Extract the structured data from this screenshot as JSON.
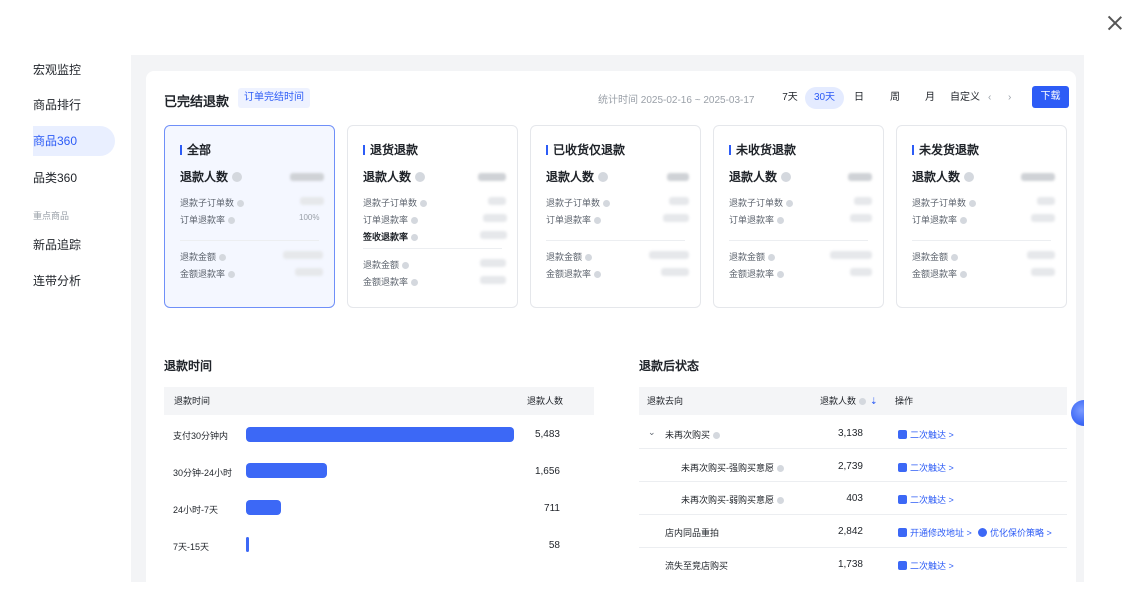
{
  "sidebar": {
    "items": [
      {
        "label": "宏观监控"
      },
      {
        "label": "商品排行"
      },
      {
        "label": "商品360"
      },
      {
        "label": "品类360"
      },
      {
        "label": "新品追踪"
      },
      {
        "label": "连带分析"
      }
    ],
    "group_label": "重点商品"
  },
  "header": {
    "title": "已完结退款",
    "tag": "订单完结时间",
    "stat_time": "统计时间 2025-02-16 ~ 2025-03-17",
    "periods": [
      "7天",
      "30天",
      "日",
      "周",
      "月",
      "自定义"
    ],
    "active_period": "30天",
    "download": "下载"
  },
  "cards": [
    {
      "title": "全部",
      "main": "退款人数",
      "metrics": [
        "退款子订单数",
        "订单退款率"
      ],
      "metrics2": [
        "退款金额",
        "金额退款率"
      ],
      "visible_value": "100%"
    },
    {
      "title": "退货退款",
      "main": "退款人数",
      "metrics": [
        "退款子订单数",
        "订单退款率"
      ],
      "bold_metric": "签收退款率",
      "metrics2": [
        "退款金额",
        "金额退款率"
      ]
    },
    {
      "title": "已收货仅退款",
      "main": "退款人数",
      "metrics": [
        "退款子订单数",
        "订单退款率"
      ],
      "metrics2": [
        "退款金额",
        "金额退款率"
      ]
    },
    {
      "title": "未收货退款",
      "main": "退款人数",
      "metrics": [
        "退款子订单数",
        "订单退款率"
      ],
      "metrics2": [
        "退款金额",
        "金额退款率"
      ]
    },
    {
      "title": "未发货退款",
      "main": "退款人数",
      "metrics": [
        "退款子订单数",
        "订单退款率"
      ],
      "metrics2": [
        "退款金额",
        "金额退款率"
      ]
    }
  ],
  "refund_time": {
    "title": "退款时间",
    "col1": "退款时间",
    "col2": "退款人数",
    "rows": [
      {
        "label": "支付30分钟内",
        "value": "5,483",
        "num": 5483
      },
      {
        "label": "30分钟-24小时",
        "value": "1,656",
        "num": 1656
      },
      {
        "label": "24小时-7天",
        "value": "711",
        "num": 711
      },
      {
        "label": "7天-15天",
        "value": "58",
        "num": 58
      }
    ]
  },
  "refund_status": {
    "title": "退款后状态",
    "col1": "退款去向",
    "col2": "退款人数",
    "col3": "操作",
    "rows": [
      {
        "label": "未再次购买",
        "value": "3,138",
        "actions": [
          "二次触达 >"
        ]
      },
      {
        "label": "未再次购买-强购买意愿",
        "value": "2,739",
        "actions": [
          "二次触达 >"
        ]
      },
      {
        "label": "未再次购买-弱购买意愿",
        "value": "403",
        "actions": [
          "二次触达 >"
        ]
      },
      {
        "label": "店内同品重拍",
        "value": "2,842",
        "actions": [
          "开通修改地址 >",
          "优化保价策略 >"
        ]
      },
      {
        "label": "流失至竞店购买",
        "value": "1,738",
        "actions": [
          "二次触达 >"
        ]
      }
    ]
  },
  "colors": {
    "accent": "#2d5cf6",
    "bar": "#3c68f6"
  }
}
